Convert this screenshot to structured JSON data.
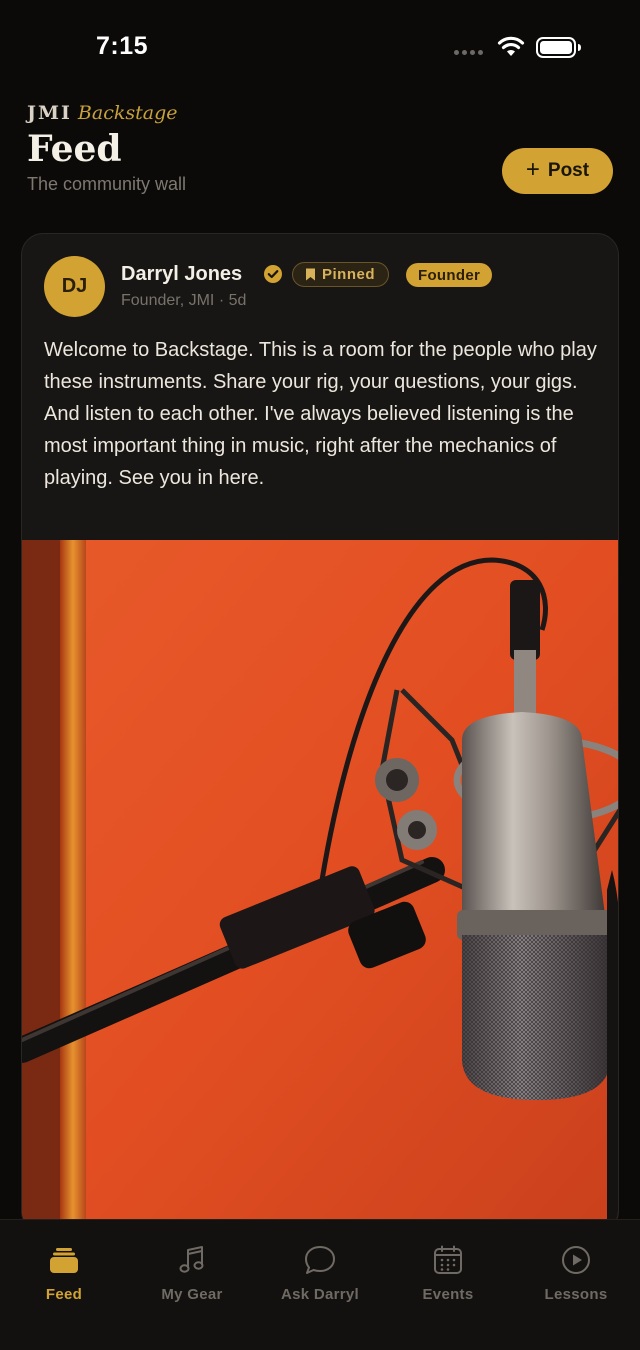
{
  "status_bar": {
    "time": "7:15"
  },
  "header": {
    "brand_jmi": "JMI",
    "brand_backstage": "Backstage",
    "title": "Feed",
    "subtitle": "The community wall",
    "post_button_label": "Post",
    "post_button_icon": "plus-icon"
  },
  "post": {
    "avatar_initials": "DJ",
    "author_name": "Darryl Jones",
    "verified_icon": "verified-check-icon",
    "pinned_label": "Pinned",
    "founder_label": "Founder",
    "meta": "Founder, JMI · 5d",
    "body": "Welcome to Backstage. This is a room for the people who play these instruments. Share your rig, your questions, your gigs. And listen to each other. I've always believed listening is the most important thing in music, right after the mechanics of playing. See you in here.",
    "image_icon": "studio-microphone-photo"
  },
  "tabs": [
    {
      "label": "Feed",
      "icon": "feed-stack-icon",
      "active": true
    },
    {
      "label": "My Gear",
      "icon": "music-note-icon",
      "active": false
    },
    {
      "label": "Ask Darryl",
      "icon": "chat-bubble-icon",
      "active": false
    },
    {
      "label": "Events",
      "icon": "calendar-icon",
      "active": false
    },
    {
      "label": "Lessons",
      "icon": "play-circle-icon",
      "active": false
    }
  ],
  "colors": {
    "background": "#0b0a09",
    "accent": "#d2a233",
    "card": "#181614",
    "text_primary": "#f2ede4",
    "text_muted": "#7d7870"
  }
}
